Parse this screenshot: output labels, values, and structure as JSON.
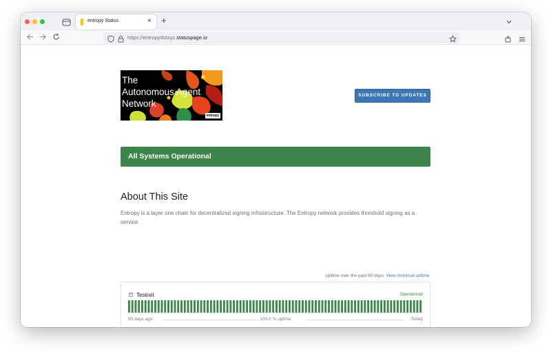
{
  "browser": {
    "tab_title": "entropy Status",
    "tab_close_icon": "×",
    "new_tab_icon": "+",
    "url_prefix": "https://entropydotxyz.",
    "url_host": "statuspage.io"
  },
  "header": {
    "logo_lines": [
      "The",
      "Autonomous Agent",
      "Network"
    ],
    "logo_mark": "entropy",
    "subscribe_label": "SUBSCRIBE TO UPDATES"
  },
  "status": {
    "banner_text": "All Systems Operational",
    "color": "#3d8548"
  },
  "about": {
    "heading": "About This Site",
    "text": "Entropy is a layer one chain for decentralized signing infrastructure. The Entropy network provides threshold signing as a service."
  },
  "uptime": {
    "note_prefix": "Uptime over the past 90 days.",
    "note_link": "View historical uptime.",
    "component_name": "Testnet",
    "component_status": "Operational",
    "days": 90,
    "bar_color": "#3d8548",
    "legend_left": "90 days ago",
    "legend_mid": "100.0 % uptime",
    "legend_right": "Today"
  },
  "colors": {
    "accent": "#3d77b6",
    "operational": "#3d8548"
  }
}
